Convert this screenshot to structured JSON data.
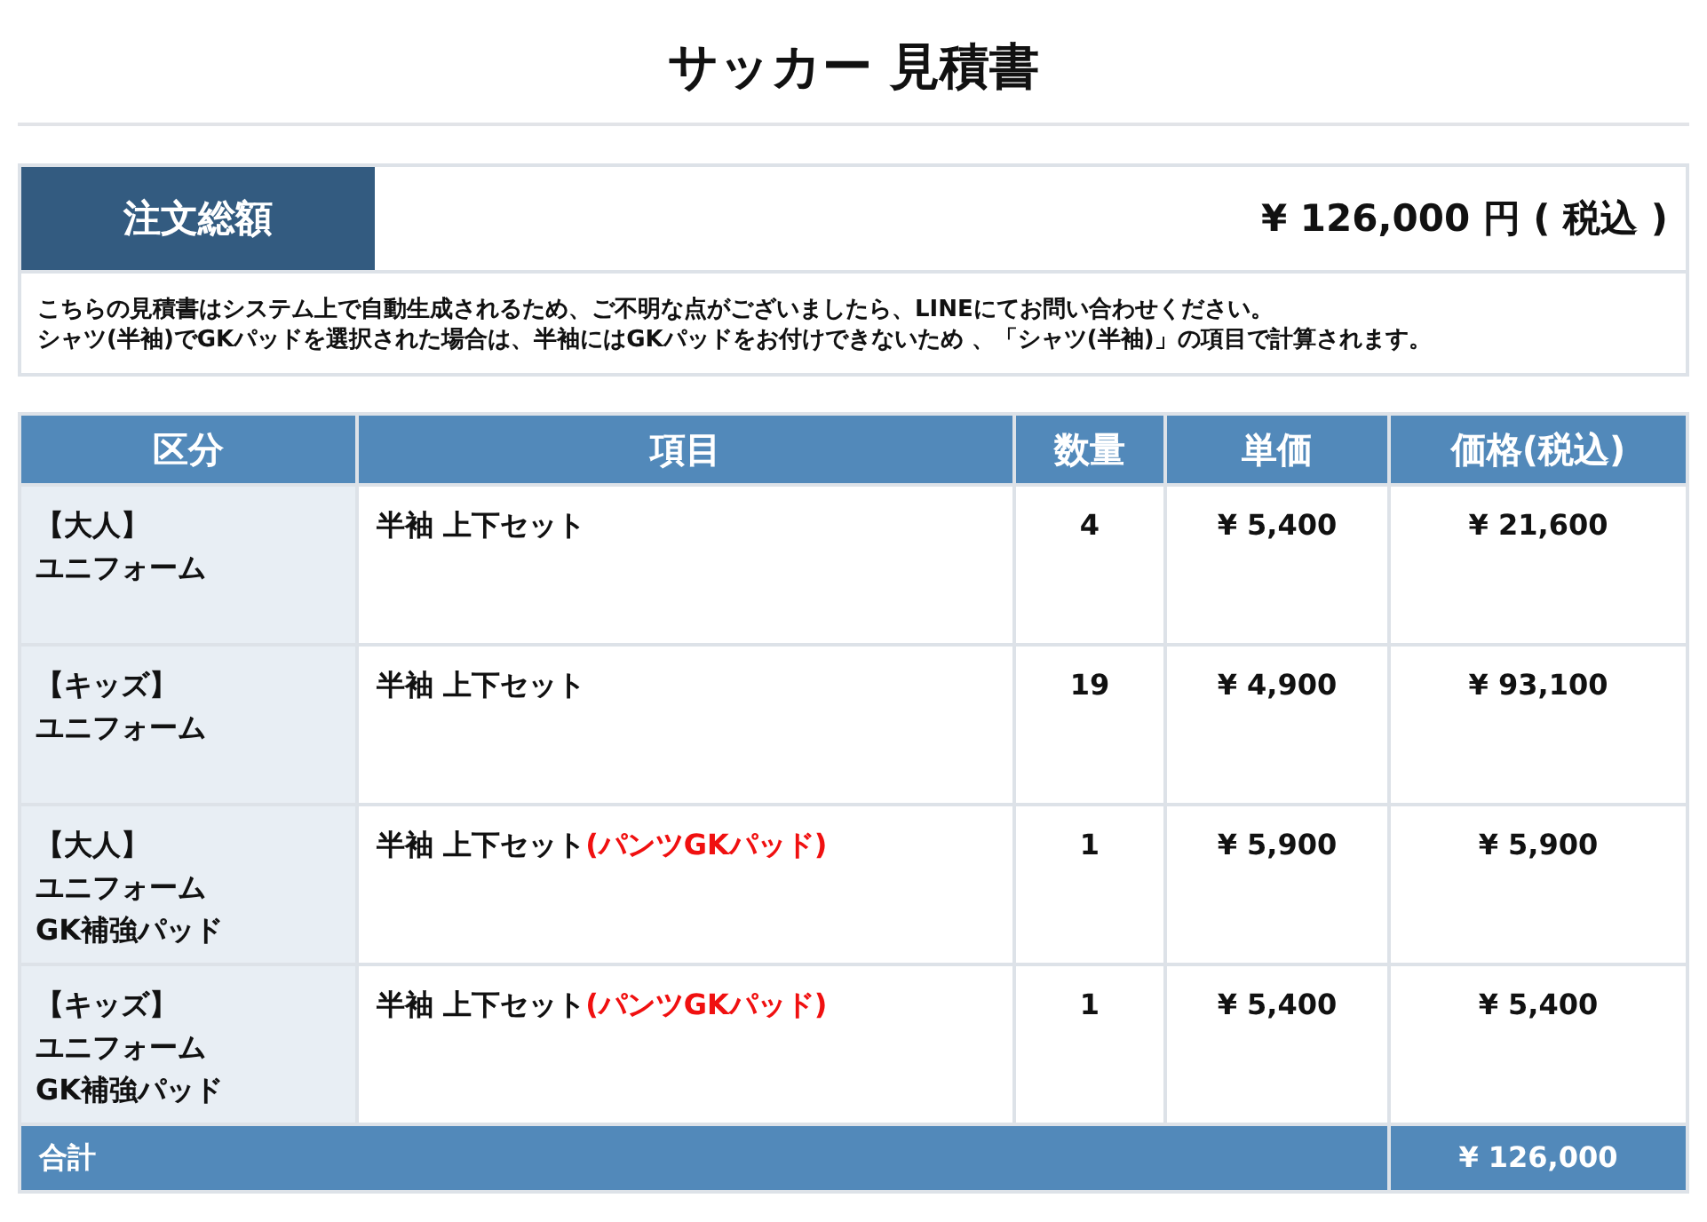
{
  "title": "サッカー 見積書",
  "summary": {
    "label": "注文総額",
    "amount": "¥ 126,000 円 ( 税込 )"
  },
  "notes": [
    "こちらの見積書はシステム上で自動生成されるため、ご不明な点がございましたら、LINEにてお問い合わせください。",
    "シャツ(半袖)でGKパッドを選択された場合は、半袖にはGKパッドをお付けできないため 、「シャツ(半袖)」の項目で計算されます。"
  ],
  "table": {
    "columns": [
      "区分",
      "項目",
      "数量",
      "単価",
      "価格(税込)"
    ],
    "rows": [
      {
        "category": [
          "【大人】",
          "ユニフォーム"
        ],
        "item": "半袖 上下セット",
        "option": "",
        "quantity": "4",
        "unit_price": "¥ 5,400",
        "price": "¥ 21,600"
      },
      {
        "category": [
          "【キッズ】",
          "ユニフォーム"
        ],
        "item": "半袖 上下セット",
        "option": "",
        "quantity": "19",
        "unit_price": "¥ 4,900",
        "price": "¥ 93,100"
      },
      {
        "category": [
          "【大人】",
          "ユニフォーム",
          "GK補強パッド"
        ],
        "item": "半袖 上下セット",
        "option": "(パンツGKパッド)",
        "quantity": "1",
        "unit_price": "¥ 5,900",
        "price": "¥ 5,900"
      },
      {
        "category": [
          "【キッズ】",
          "ユニフォーム",
          "GK補強パッド"
        ],
        "item": "半袖 上下セット",
        "option": "(パンツGKパッド)",
        "quantity": "1",
        "unit_price": "¥ 5,400",
        "price": "¥ 5,400"
      }
    ],
    "total": {
      "label": "合計",
      "amount": "¥ 126,000"
    }
  }
}
